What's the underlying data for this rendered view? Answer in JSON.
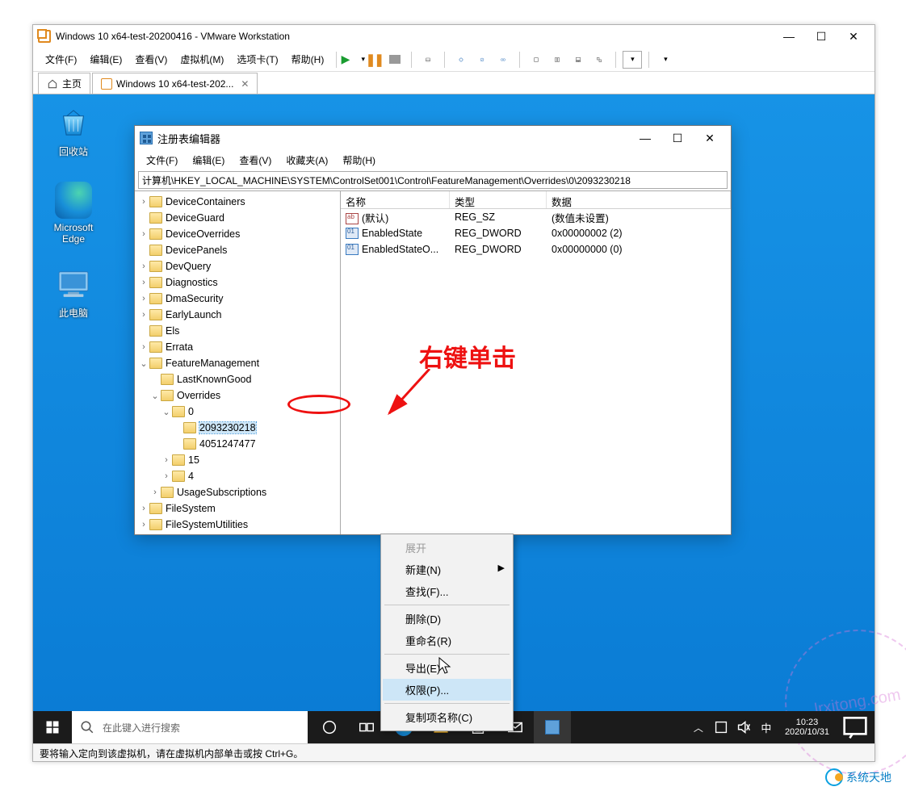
{
  "vmware": {
    "title": "Windows 10 x64-test-20200416 - VMware Workstation",
    "menu": {
      "file": "文件(F)",
      "edit": "编辑(E)",
      "view": "查看(V)",
      "vm": "虚拟机(M)",
      "tabs": "选项卡(T)",
      "help": "帮助(H)"
    },
    "tabs": {
      "home": "主页",
      "active": "Windows 10 x64-test-202..."
    },
    "status": "要将输入定向到该虚拟机，请在虚拟机内部单击或按 Ctrl+G。"
  },
  "desktop": {
    "recycle": "回收站",
    "edge": "Microsoft Edge",
    "pc": "此电脑"
  },
  "regedit": {
    "title": "注册表编辑器",
    "menu": {
      "file": "文件(F)",
      "edit": "编辑(E)",
      "view": "查看(V)",
      "fav": "收藏夹(A)",
      "help": "帮助(H)"
    },
    "addr": "计算机\\HKEY_LOCAL_MACHINE\\SYSTEM\\ControlSet001\\Control\\FeatureManagement\\Overrides\\0\\2093230218",
    "tree": [
      "DeviceContainers",
      "DeviceGuard",
      "DeviceOverrides",
      "DevicePanels",
      "DevQuery",
      "Diagnostics",
      "DmaSecurity",
      "EarlyLaunch",
      "Els",
      "Errata",
      "FeatureManagement",
      "LastKnownGood",
      "Overrides",
      "0",
      "2093230218",
      "4051247477",
      "15",
      "4",
      "UsageSubscriptions",
      "FileSystem",
      "FileSystemUtilities"
    ],
    "cols": {
      "name": "名称",
      "type": "类型",
      "data": "数据"
    },
    "rows": [
      {
        "name": "(默认)",
        "type": "REG_SZ",
        "data": "(数值未设置)",
        "ico": "sz"
      },
      {
        "name": "EnabledState",
        "type": "REG_DWORD",
        "data": "0x00000002 (2)",
        "ico": "dw"
      },
      {
        "name": "EnabledStateO...",
        "type": "REG_DWORD",
        "data": "0x00000000 (0)",
        "ico": "dw"
      }
    ]
  },
  "ctx": {
    "expand": "展开",
    "new": "新建(N)",
    "find": "查找(F)...",
    "delete": "删除(D)",
    "rename": "重命名(R)",
    "export": "导出(E)",
    "perm": "权限(P)...",
    "copy": "复制项名称(C)"
  },
  "anno": {
    "label": "右键单击"
  },
  "taskbar": {
    "search_placeholder": "在此键入进行搜索",
    "ime": "中",
    "time": "10:23",
    "date": "2020/10/31"
  },
  "watermark": {
    "text": "lrxitong.com",
    "brand": "系统天地"
  }
}
